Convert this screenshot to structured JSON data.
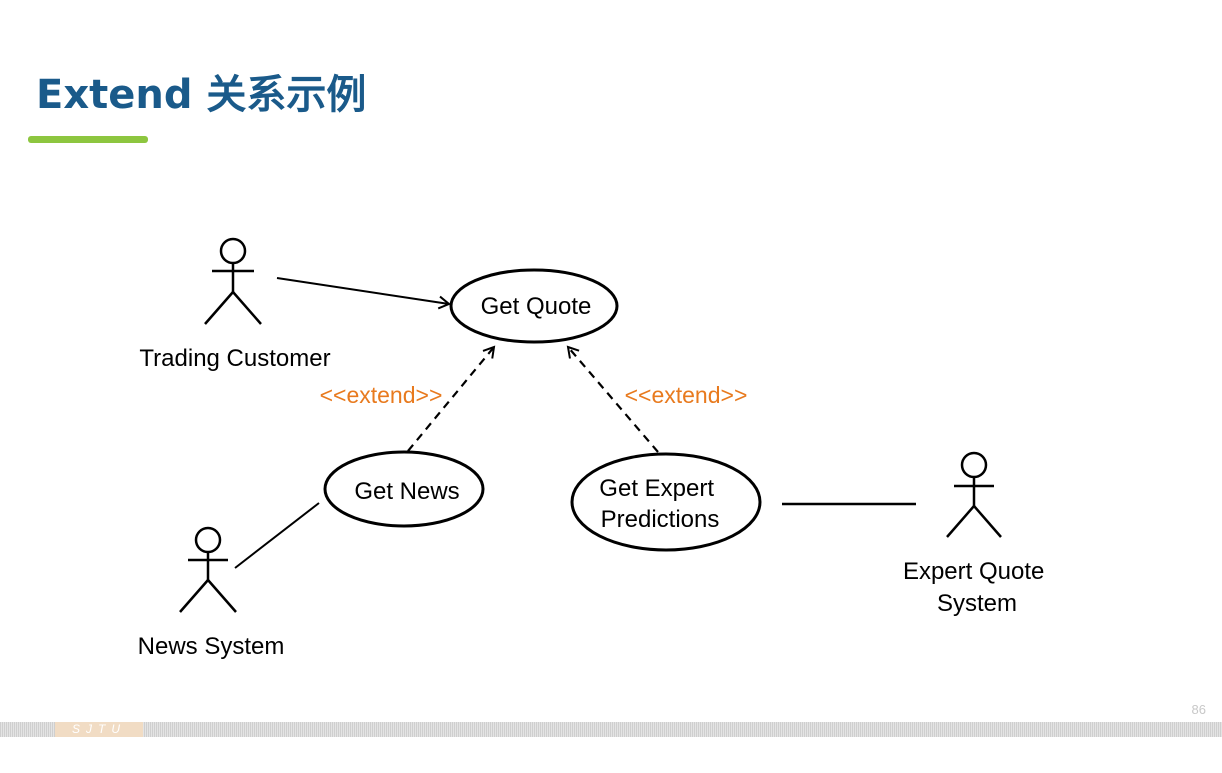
{
  "slide": {
    "title": "Extend 关系示例",
    "page_number": "86",
    "footer_logo": "SJTU"
  },
  "colors": {
    "title": "#1a5a8a",
    "underline": "#8dc63f",
    "stereotype": "#e87a1e"
  },
  "diagram": {
    "actors": {
      "trading_customer": "Trading Customer",
      "news_system": "News System",
      "expert_quote_system": [
        "Expert Quote",
        "System"
      ]
    },
    "use_cases": {
      "get_quote": "Get Quote",
      "get_news": "Get News",
      "get_expert_predictions": [
        "Get Expert",
        "Predictions"
      ]
    },
    "stereotypes": {
      "left": "<<extend>>",
      "right": "<<extend>>"
    }
  }
}
